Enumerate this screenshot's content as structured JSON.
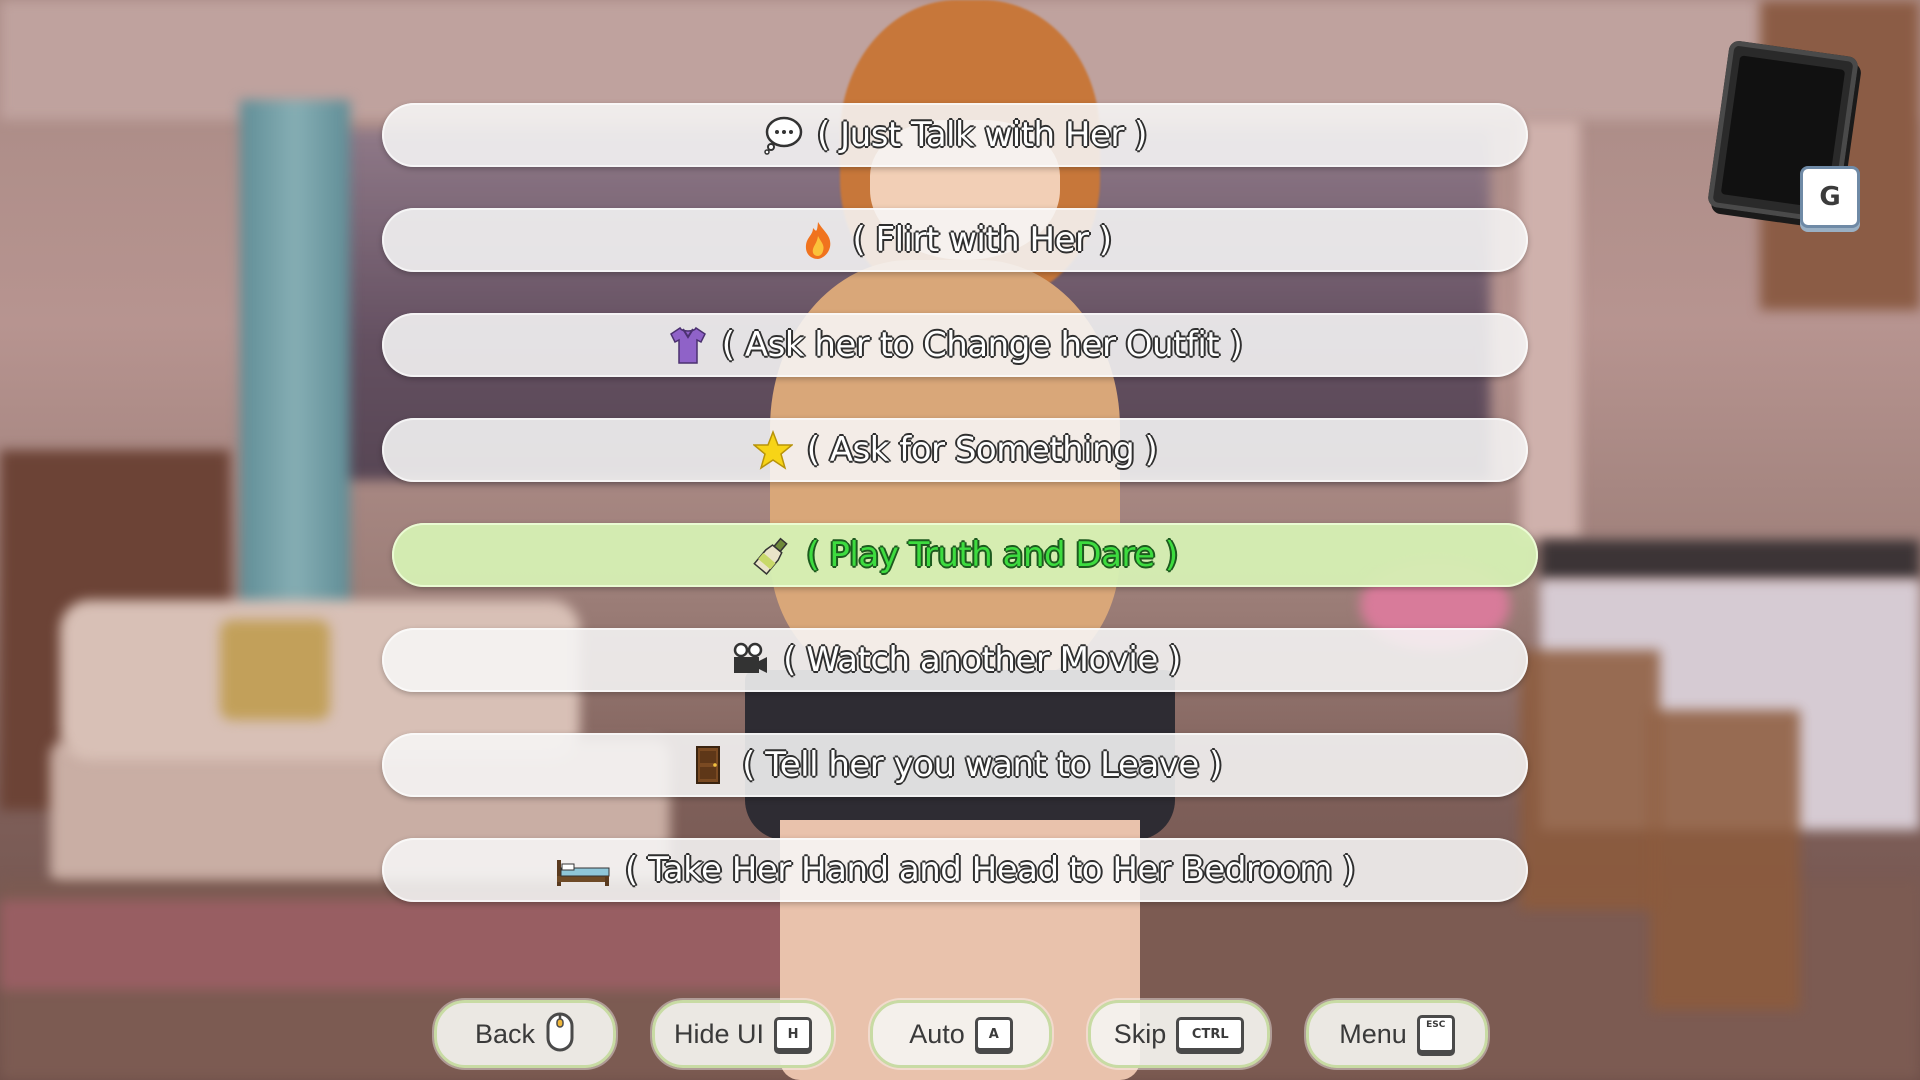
{
  "choices": [
    {
      "label": "( Just Talk with Her )",
      "icon": "speech-bubble-icon",
      "selected": false
    },
    {
      "label": "( Flirt with Her )",
      "icon": "fire-icon",
      "selected": false
    },
    {
      "label": "( Ask her to Change her Outfit )",
      "icon": "shirt-icon",
      "selected": false
    },
    {
      "label": "( Ask for Something )",
      "icon": "star-icon",
      "selected": false
    },
    {
      "label": "( Play Truth and Dare )",
      "icon": "bottle-icon",
      "selected": true
    },
    {
      "label": "( Watch another Movie )",
      "icon": "movie-camera-icon",
      "selected": false
    },
    {
      "label": "( Tell her you want to Leave )",
      "icon": "door-icon",
      "selected": false
    },
    {
      "label": "( Take Her Hand and Head to Her Bedroom )",
      "icon": "bed-icon",
      "selected": false
    }
  ],
  "phone": {
    "key": "G"
  },
  "quick_menu": {
    "back": {
      "label": "Back",
      "key": "",
      "icon": "mouse-icon"
    },
    "hide_ui": {
      "label": "Hide UI",
      "key": "H"
    },
    "auto": {
      "label": "Auto",
      "key": "A"
    },
    "skip": {
      "label": "Skip",
      "key": "CTRL"
    },
    "menu": {
      "label": "Menu",
      "key": "ESC"
    }
  },
  "colors": {
    "choice_bg": "#f6f6f6",
    "choice_selected_bg": "#d6f0b4",
    "choice_selected_text": "#3ddc3f",
    "quick_btn_border": "#c8dba4"
  }
}
